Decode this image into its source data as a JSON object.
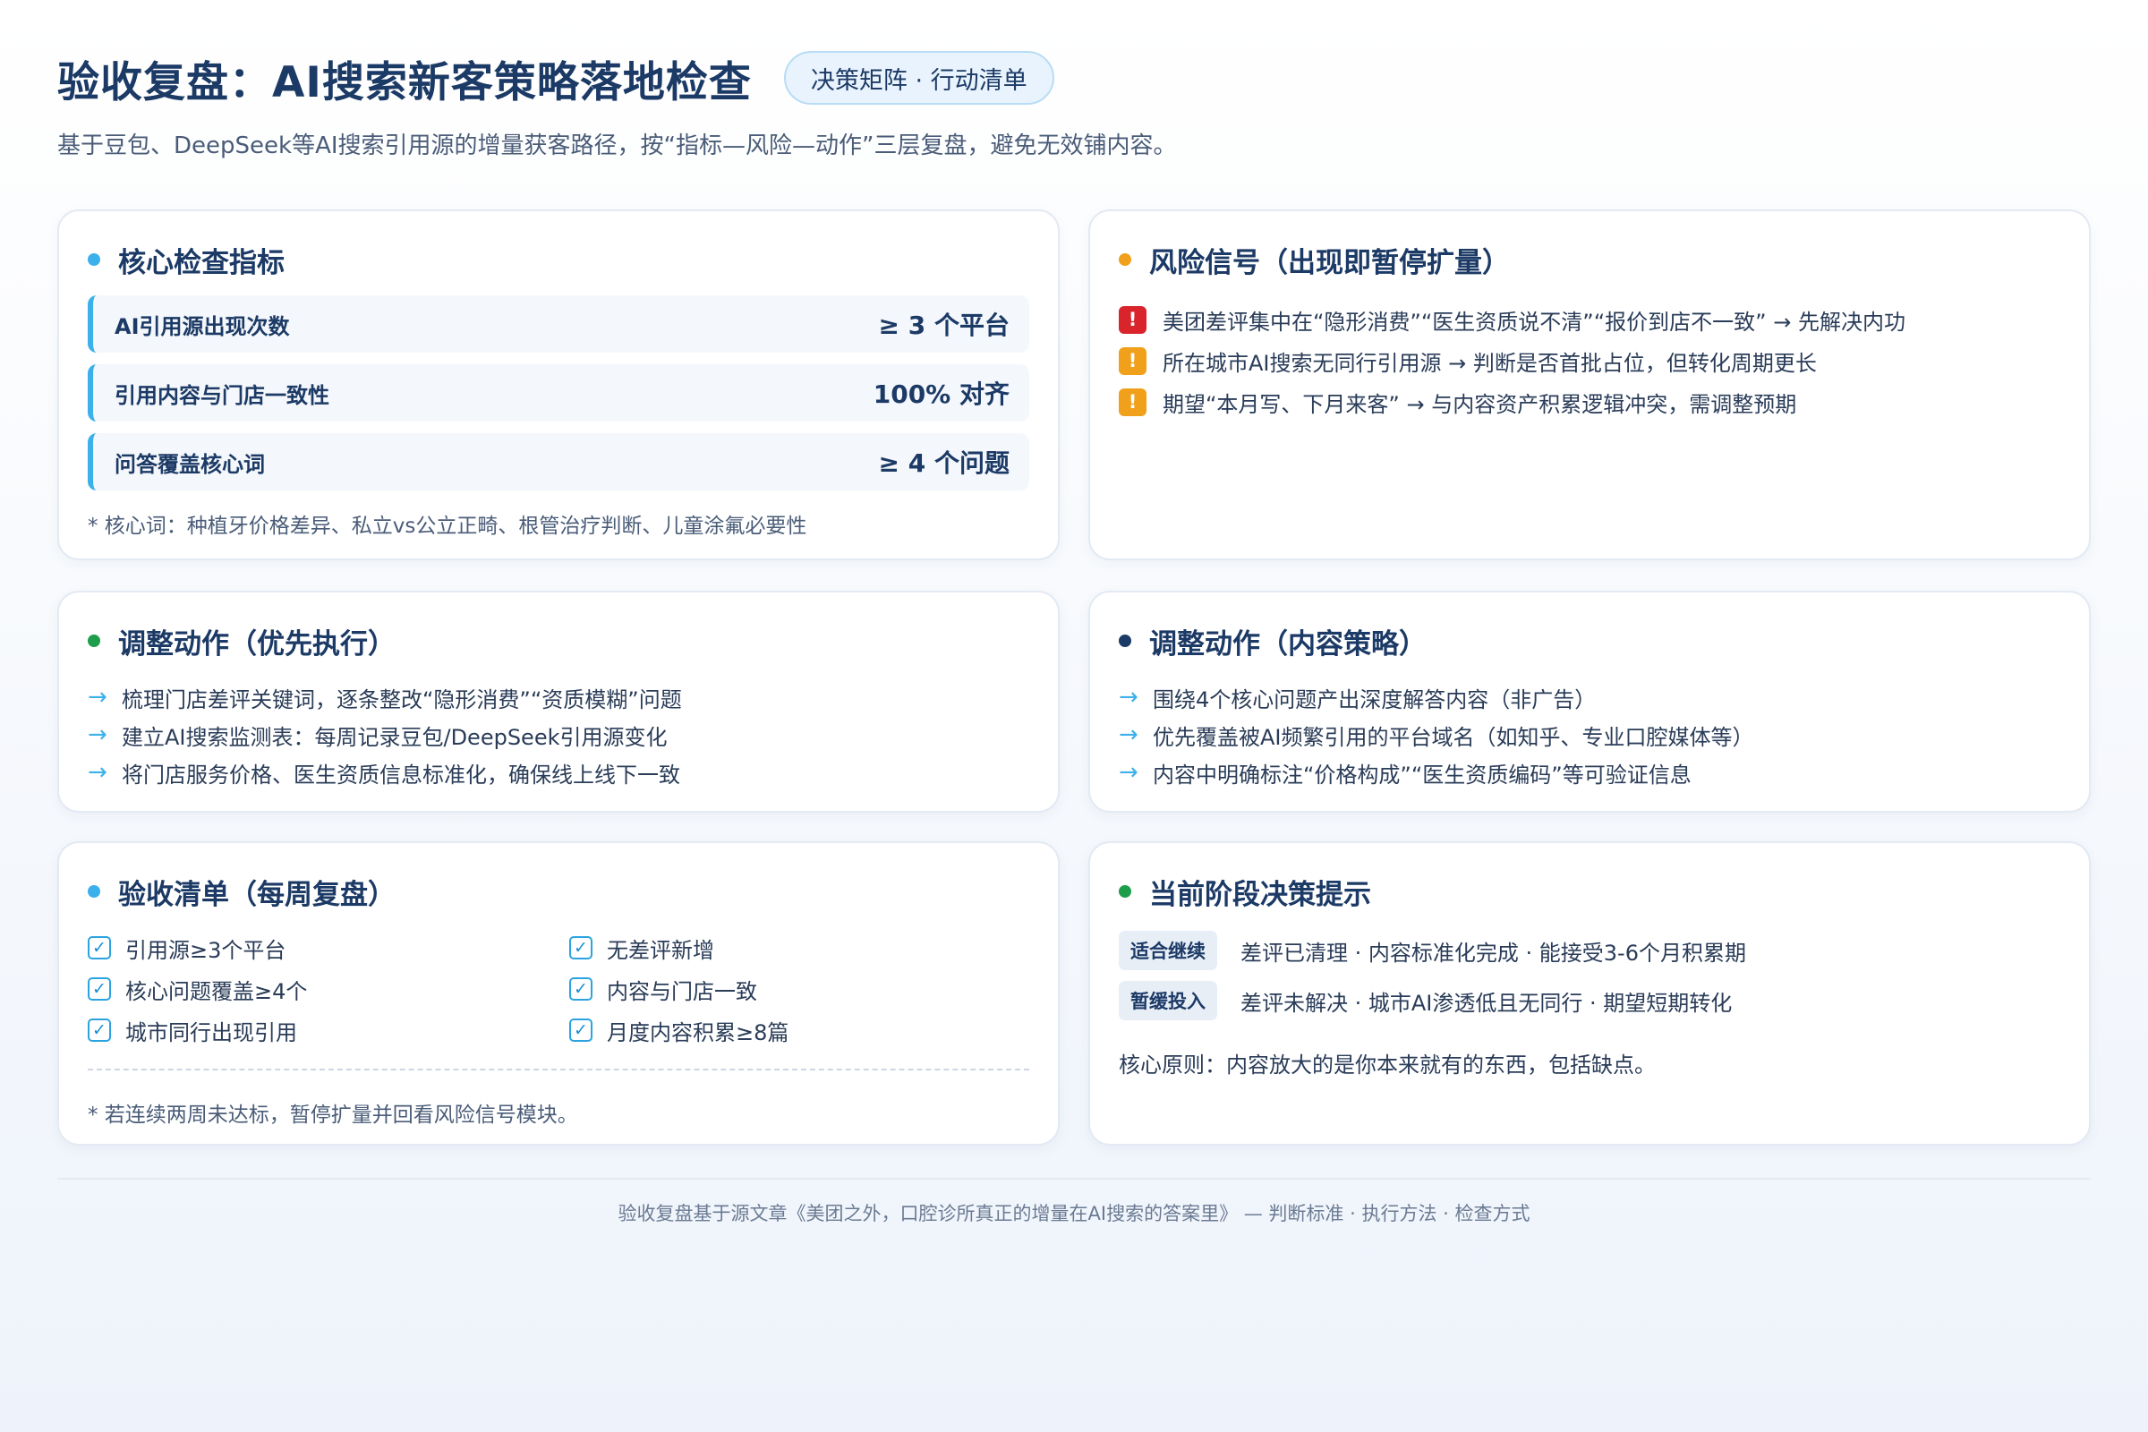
{
  "header": {
    "title": "验收复盘：AI搜索新客策略落地检查",
    "chip": "决策矩阵 · 行动清单",
    "subtitle": "基于豆包、DeepSeek等AI搜索引用源的增量获客路径，按“指标—风险—动作”三层复盘，避免无效铺内容。"
  },
  "colors": {
    "blue_dot": "#3bb0ea",
    "orange_dot": "#f0a01a",
    "green_dot": "#1e9e4a",
    "navy_dot": "#1c3a66",
    "risk_red": "#d9242c",
    "risk_orange": "#f0a01a"
  },
  "metrics_card": {
    "title": "核心检查指标",
    "items": [
      {
        "name": "AI引用源出现次数",
        "value": "≥ 3 个平台"
      },
      {
        "name": "引用内容与门店一致性",
        "value": "100% 对齐"
      },
      {
        "name": "问答覆盖核心词",
        "value": "≥ 4 个问题"
      }
    ],
    "footnote": "* 核心词：种植牙价格差异、私立vs公立正畸、根管治疗判断、儿童涂氟必要性"
  },
  "risk_card": {
    "title": "风险信号（出现即暂停扩量）",
    "items": [
      {
        "icon": "!",
        "level": "red",
        "text": "美团差评集中在“隐形消费”“医生资质说不清”“报价到店不一致” → 先解决内功"
      },
      {
        "icon": "!",
        "level": "orange",
        "text": "所在城市AI搜索无同行引用源 → 判断是否首批占位，但转化周期更长"
      },
      {
        "icon": "!",
        "level": "orange",
        "text": "期望“本月写、下月来客” → 与内容资产积累逻辑冲突，需调整预期"
      }
    ]
  },
  "priority_card": {
    "title": "调整动作（优先执行）",
    "arrow": "→",
    "items": [
      "梳理门店差评关键词，逐条整改“隐形消费”“资质模糊”问题",
      "建立AI搜索监测表：每周记录豆包/DeepSeek引用源变化",
      "将门店服务价格、医生资质信息标准化，确保线上线下一致"
    ]
  },
  "content_card": {
    "title": "调整动作（内容策略）",
    "arrow": "→",
    "items": [
      "围绕4个核心问题产出深度解答内容（非广告）",
      "优先覆盖被AI频繁引用的平台域名（如知乎、专业口腔媒体等）",
      "内容中明确标注“价格构成”“医生资质编码”等可验证信息"
    ]
  },
  "checklist_card": {
    "title": "验收清单（每周复盘）",
    "check_mark": "✓",
    "left": [
      "引用源≥3个平台",
      "核心问题覆盖≥4个",
      "城市同行出现引用"
    ],
    "right": [
      "无差评新增",
      "内容与门店一致",
      "月度内容积累≥8篇"
    ],
    "note": "* 若连续两周未达标，暂停扩量并回看风险信号模块。"
  },
  "decision_card": {
    "title": "当前阶段决策提示",
    "rows": [
      {
        "tag": "适合继续",
        "text": "差评已清理 · 内容标准化完成 · 能接受3-6个月积累期"
      },
      {
        "tag": "暂缓投入",
        "text": "差评未解决 · 城市AI渗透低且无同行 · 期望短期转化"
      }
    ],
    "principle": "核心原则：内容放大的是你本来就有的东西，包括缺点。"
  },
  "footer": {
    "text": "验收复盘基于源文章《美团之外，口腔诊所真正的增量在AI搜索的答案里》 — 判断标准 · 执行方法 · 检查方式"
  }
}
